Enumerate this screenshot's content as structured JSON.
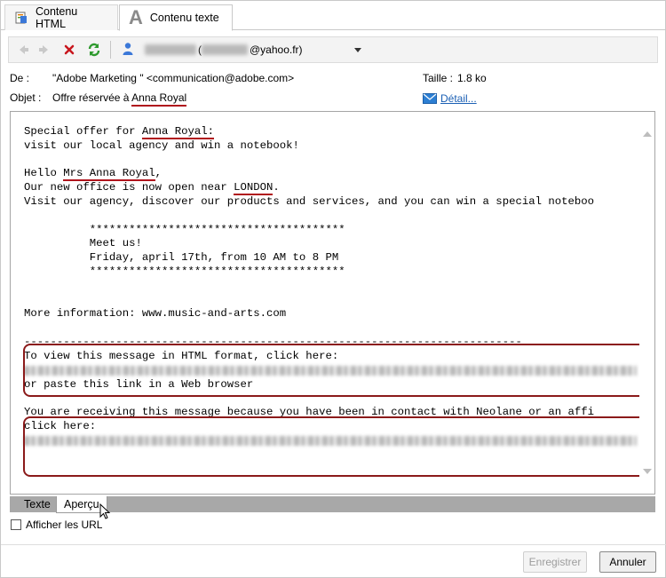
{
  "tabs": [
    {
      "label": "Contenu HTML",
      "icon": "html-content-icon"
    },
    {
      "label": "Contenu texte",
      "icon": "text-content-icon",
      "active": true
    }
  ],
  "toolbar": {
    "recipient_suffix": "@yahoo.fr)",
    "recipient_open_paren": "("
  },
  "header": {
    "from_label": "De :",
    "from_value": "\"Adobe Marketing \" <communication@adobe.com>",
    "subject_label": "Objet :",
    "subject_prefix": "Offre réservée à ",
    "subject_name": "Anna Royal",
    "size_label": "Taille :",
    "size_value": "1.8 ko",
    "detail_link": "Détail..."
  },
  "body": {
    "line1_prefix": "Special offer for ",
    "line1_name": "Anna Royal:",
    "line2": "visit our local agency and win a notebook!",
    "hello_prefix": "Hello ",
    "hello_name": "Mrs Anna Royal",
    "hello_suffix": ",",
    "office_prefix": "Our new office is now open near ",
    "office_city": "LONDON",
    "office_suffix": ".",
    "visit_line": "Visit our agency, discover our products and services, and you can win a special noteboo",
    "stars_top": "          ***************************************",
    "meet_line": "          Meet us!",
    "date_line": "          Friday, april 17th, from 10 AM to 8 PM",
    "stars_bottom": "          ***************************************",
    "more_info": "More information: www.music-and-arts.com",
    "dashes": "----------------------------------------------------------------------------",
    "view_html": "To view this message in HTML format, click here:",
    "paste_link": "or paste this link in a Web browser",
    "receiving": "You are receiving this message because you have been in contact with Neolane or an affi",
    "click_here": "click here:"
  },
  "view_tabs": {
    "texte": "Texte",
    "apercu": "Aperçu"
  },
  "show_urls_label": "Afficher les URL",
  "buttons": {
    "save": "Enregistrer",
    "cancel": "Annuler"
  }
}
